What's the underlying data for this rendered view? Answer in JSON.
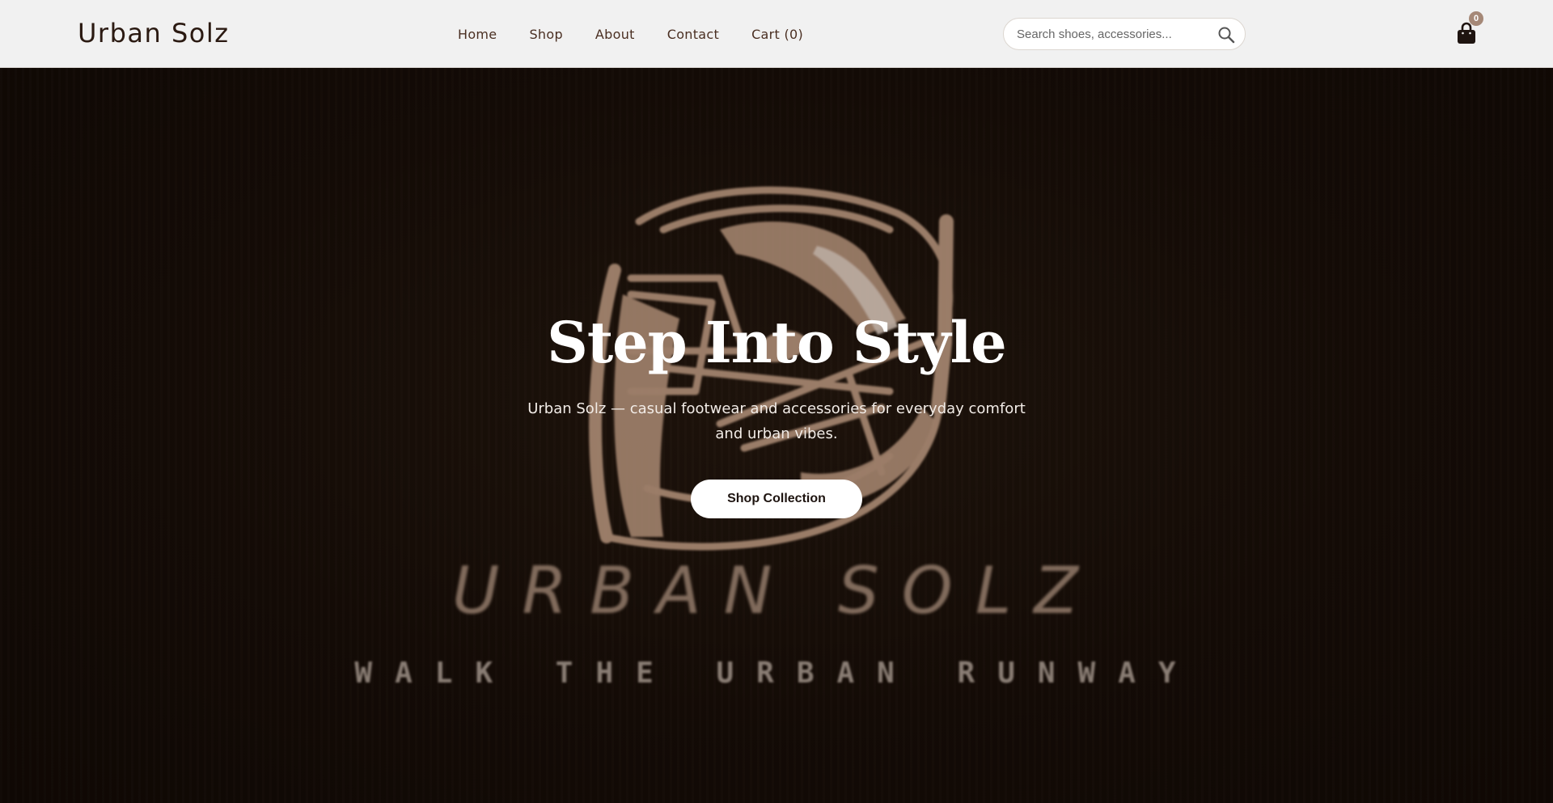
{
  "header": {
    "brand": "Urban Solz",
    "nav": [
      {
        "label": "Home"
      },
      {
        "label": "Shop"
      },
      {
        "label": "About"
      },
      {
        "label": "Contact"
      },
      {
        "label": "Cart (0)"
      }
    ],
    "search": {
      "placeholder": "Search shoes, accessories...",
      "value": ""
    },
    "cart": {
      "count": "0",
      "icon": "shopping-bag-icon"
    }
  },
  "hero": {
    "title": "Step Into Style",
    "subtitle": "Urban Solz — casual footwear and accessories for everyday comfort and urban vibes.",
    "cta_label": "Shop Collection",
    "logo_wordmark": "URBAN SOLZ",
    "logo_tagline": "WALK THE URBAN RUNWAY"
  },
  "colors": {
    "header_bg": "#f1f1f1",
    "hero_bg": "#140b06",
    "accent": "#a58877",
    "text_dark": "#2b1a12"
  }
}
